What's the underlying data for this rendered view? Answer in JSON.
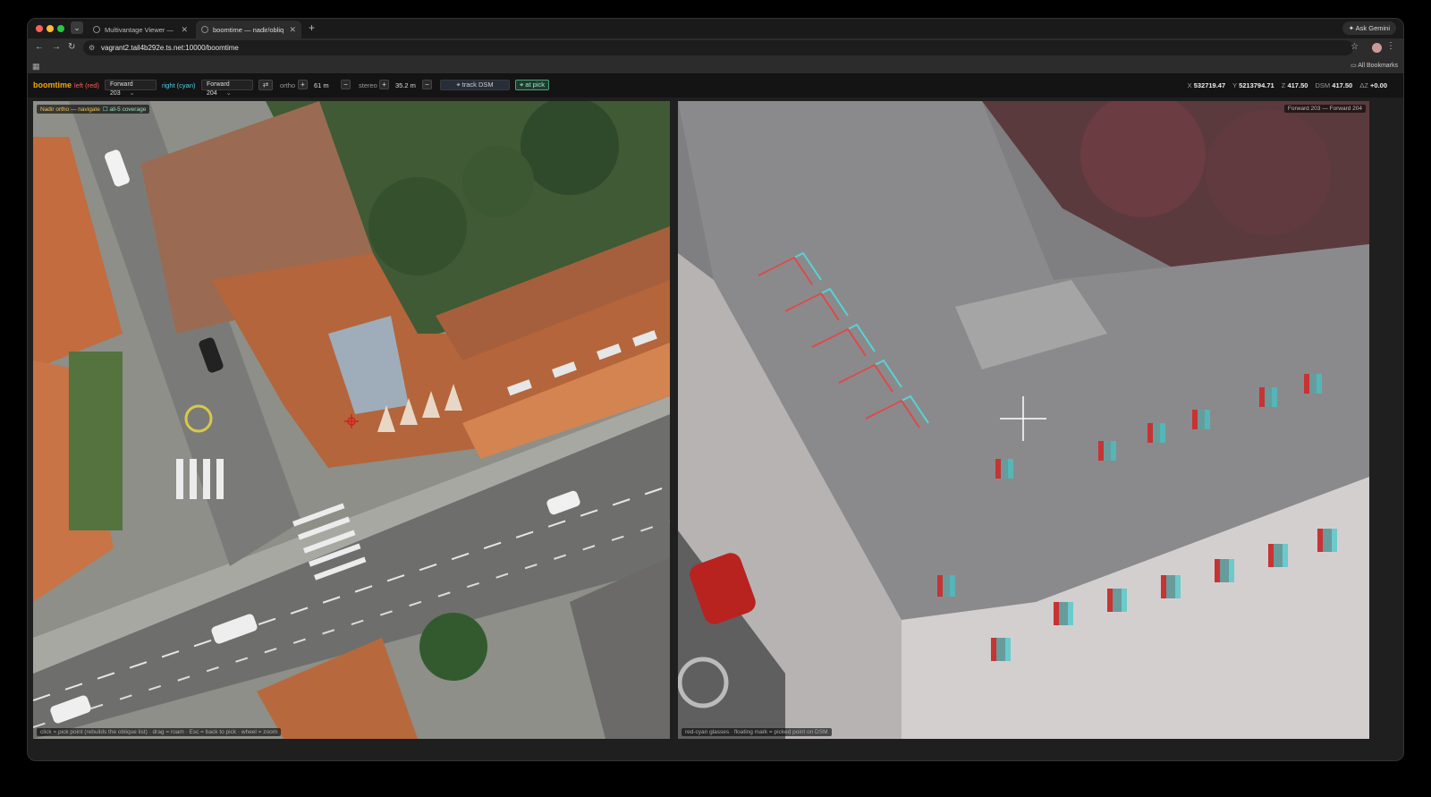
{
  "browser": {
    "tabs": [
      {
        "title": "Multivantage Viewer — Drag...",
        "active": false
      },
      {
        "title": "boomtime — nadir/oblique st...",
        "active": true
      }
    ],
    "new_tab": "+",
    "gemini_label": "Ask Gemini",
    "url": "vagrant2.tail4b292e.ts.net:10000/boomtime",
    "bookmarks_label": "All Bookmarks"
  },
  "app": {
    "brand": "boomtime",
    "left_label": "left (red)",
    "left_select": "Forward 203",
    "right_label": "right (cyan)",
    "right_select": "Forward 204",
    "swap_icon": "⇄",
    "ortho_label": "ortho",
    "ortho_value": "61 m",
    "stereo_label": "stereo",
    "stereo_value": "35.2 m",
    "plus": "+",
    "minus": "−",
    "track_dsm": "⌖ track DSM",
    "at_pick": "⌖ at pick",
    "coords": {
      "x_label": "X",
      "x": "532719.47",
      "y_label": "Y",
      "y": "5213794.71",
      "z_label": "Z",
      "z": "417.50",
      "dsm_label": "DSM",
      "dsm": "417.50",
      "dz_label": "ΔZ",
      "dz": "+0.00"
    }
  },
  "left_view": {
    "badge": "Nadir ortho — navigate",
    "coverage": "☐ all-5 coverage",
    "hint": "click = pick point (rebuilds the oblique list) · drag = roam · Esc = back to pick · wheel = zoom"
  },
  "right_view": {
    "badge": "Forward 203 — Forward 204",
    "hint": "red-cyan glasses · floating mark = picked point on DSM"
  }
}
